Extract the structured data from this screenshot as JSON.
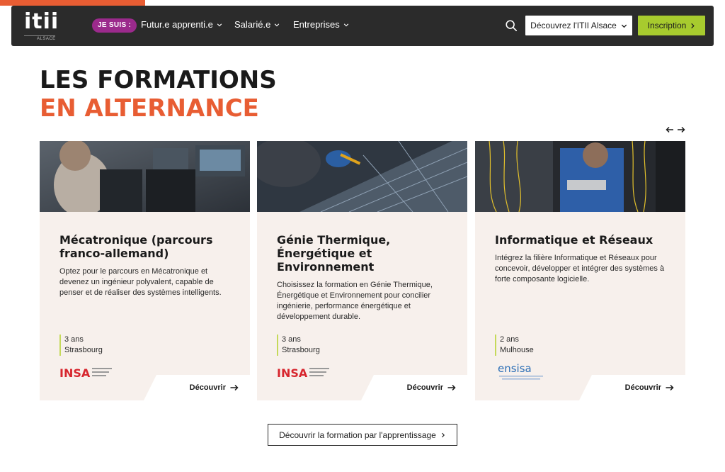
{
  "header": {
    "logo": {
      "text": "itii",
      "subtext": "ALSACE"
    },
    "badge": "JE SUIS :",
    "nav": [
      {
        "label": "Futur.e apprenti.e"
      },
      {
        "label": "Salarié.e"
      },
      {
        "label": "Entreprises"
      }
    ],
    "discover_label": "Découvrez l'ITII Alsace",
    "inscription_label": "Inscription",
    "icons": {
      "search": "search-icon",
      "chevron": "chevron-down-icon"
    }
  },
  "section": {
    "title_line1": "LES FORMATIONS",
    "title_line2": "EN ALTERNANCE"
  },
  "cards": [
    {
      "title": "Mécatronique (parcours franco-allemand)",
      "description": "Optez pour le parcours en Mécatronique et devenez un ingénieur polyvalent, capable de penser et de réaliser des systèmes intelligents.",
      "duration": "3 ans",
      "city": "Strasbourg",
      "school_logo": "INSA",
      "school_logo_sub": "INSTITUT NATIONAL DES SCIENCES APPLIQUÉES STRASBOURG",
      "link_label": "Découvrir"
    },
    {
      "title": "Génie Thermique, Énergétique et Environnement",
      "description": "Choisissez la formation en Génie Thermique, Énergétique et Environnement pour concilier ingénierie, performance énergétique et développement durable.",
      "duration": "3 ans",
      "city": "Strasbourg",
      "school_logo": "INSA",
      "school_logo_sub": "INSTITUT NATIONAL DES SCIENCES APPLIQUÉES STRASBOURG",
      "link_label": "Découvrir"
    },
    {
      "title": "Informatique et Réseaux",
      "description": "Intégrez la filière Informatique et Réseaux pour concevoir, développer et intégrer des systèmes à forte composante logicielle.",
      "duration": "2 ans",
      "city": "Mulhouse",
      "school_logo": "ensisa",
      "school_logo_sub": "École nationale supérieure d'ingénieurs sud Alsace",
      "link_label": "Découvrir"
    }
  ],
  "bottom_button": "Découvrir la formation par l'apprentissage",
  "colors": {
    "accent_orange": "#e85d33",
    "brand_green": "#a7cb2e",
    "badge_purple": "#9b2a8c",
    "nav_dark": "#2b2b2b",
    "card_bg": "#f7f0ec",
    "insa_red": "#d7262e",
    "ensisa_blue": "#2d6fb6"
  }
}
